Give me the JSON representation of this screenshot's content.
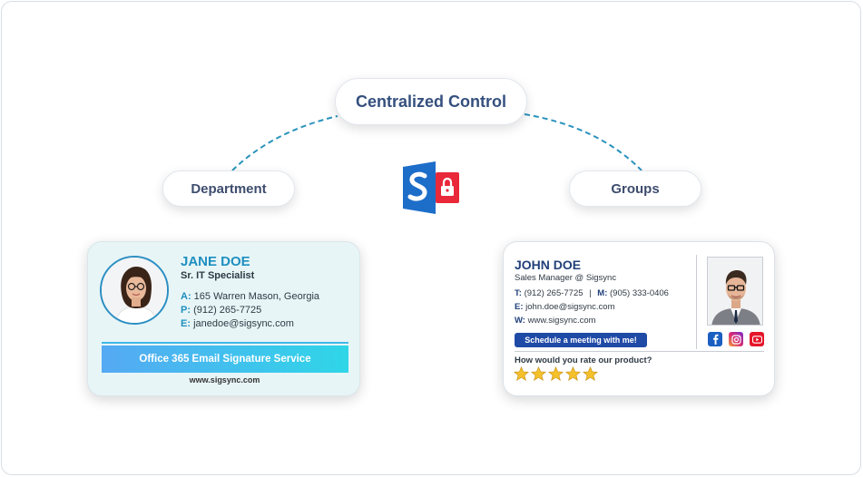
{
  "center": {
    "label": "Centralized Control"
  },
  "left_node": {
    "label": "Department"
  },
  "right_node": {
    "label": "Groups"
  },
  "colors": {
    "accent": "#1e8fbf",
    "navy": "#21407a",
    "arc": "#2b93bd",
    "logo_blue": "#1d6ec9",
    "lock_red": "#e9283a"
  },
  "jane": {
    "name": "JANE DOE",
    "title": "Sr. IT Specialist",
    "address_label": "A:",
    "address": "165 Warren Mason, Georgia",
    "phone_label": "P:",
    "phone": "(912) 265-7725",
    "email_label": "E:",
    "email": "janedoe@sigsync.com",
    "banner": "Office 365 Email Signature Service",
    "website": "www.sigsync.com"
  },
  "john": {
    "name": "JOHN DOE",
    "title": "Sales Manager @ Sigsync",
    "tel_label": "T:",
    "tel": "(912) 265-7725",
    "separator": "|",
    "mobile_label": "M:",
    "mobile": "(905) 333-0406",
    "email_label": "E:",
    "email": "john.doe@sigsync.com",
    "web_label": "W:",
    "web": "www.sigsync.com",
    "cta": "Schedule a meeting with me!",
    "rating_question": "How would you rate our product?",
    "rating": {
      "value": 5,
      "max": 5
    },
    "social_icons": [
      "facebook-icon",
      "instagram-icon",
      "youtube-icon"
    ]
  }
}
